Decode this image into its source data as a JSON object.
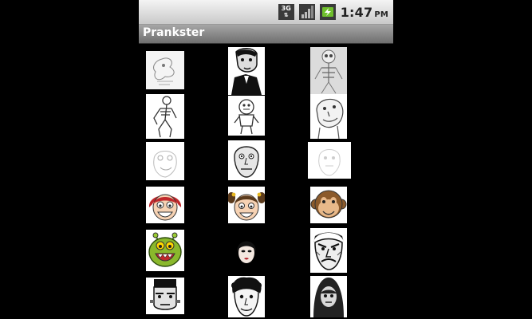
{
  "status_bar": {
    "network": "3G",
    "time": "1:47",
    "ampm": "PM"
  },
  "app": {
    "title": "Prankster"
  },
  "faces": [
    {
      "icon": "sketch-face-1-icon"
    },
    {
      "icon": "man-in-suit-icon"
    },
    {
      "icon": "skeleton-sketch-icon"
    },
    {
      "icon": "skeleton-figure-icon"
    },
    {
      "icon": "small-creature-icon"
    },
    {
      "icon": "old-man-sketch-icon"
    },
    {
      "icon": "faded-face-icon"
    },
    {
      "icon": "bald-man-face-icon"
    },
    {
      "icon": "faded-sketch-face-icon"
    },
    {
      "icon": "redhead-girl-icon"
    },
    {
      "icon": "pigtail-girl-icon"
    },
    {
      "icon": "monkey-face-icon"
    },
    {
      "icon": "green-monster-icon"
    },
    {
      "icon": "woman-face-icon"
    },
    {
      "icon": "angry-old-man-icon"
    },
    {
      "icon": "frankenstein-face-icon"
    },
    {
      "icon": "curly-hair-man-icon"
    },
    {
      "icon": "hooded-figure-icon"
    }
  ]
}
